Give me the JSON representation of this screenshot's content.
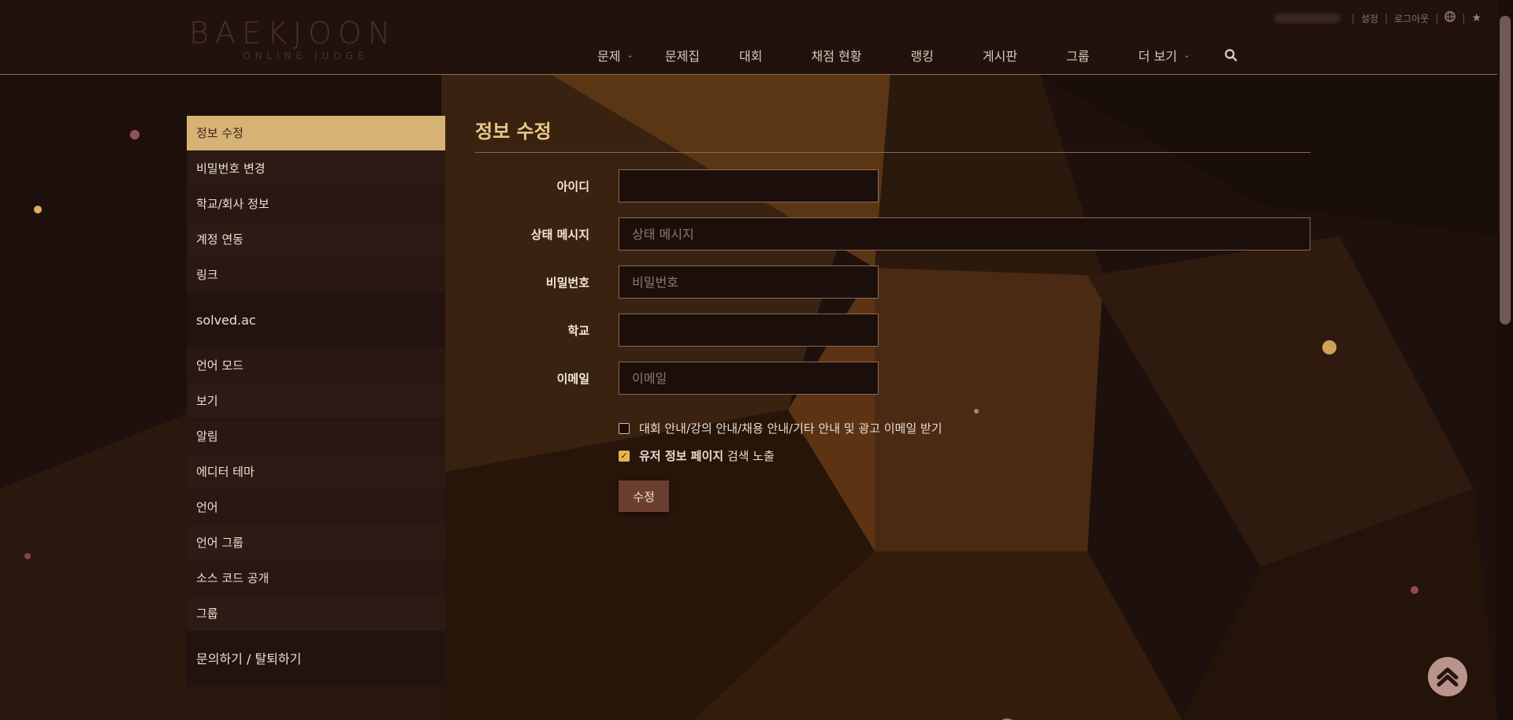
{
  "brand": {
    "name": "BAEKJOON",
    "subtitle": "ONLINE JUDGE"
  },
  "util": {
    "settings": "설정",
    "logout": "로그아웃"
  },
  "nav": [
    {
      "label": "문제",
      "dropdown": true
    },
    {
      "label": "문제집",
      "dropdown": false
    },
    {
      "label": "대회",
      "dropdown": false
    },
    {
      "label": "채점 현황",
      "dropdown": false
    },
    {
      "label": "랭킹",
      "dropdown": false
    },
    {
      "label": "게시판",
      "dropdown": false
    },
    {
      "label": "그룹",
      "dropdown": false
    },
    {
      "label": "더 보기",
      "dropdown": true
    }
  ],
  "sidebar": {
    "items": [
      "정보 수정",
      "비밀번호 변경",
      "학교/회사 정보",
      "계정 연동",
      "링크",
      "solved.ac",
      "언어 모드",
      "보기",
      "알림",
      "에디터 테마",
      "언어",
      "언어 그룹",
      "소스 코드 공개",
      "그룹",
      "문의하기 / 탈퇴하기"
    ]
  },
  "form": {
    "title": "정보 수정",
    "id_label": "아이디",
    "id_value": "",
    "status_label": "상태 메시지",
    "status_placeholder": "상태 메시지",
    "password_label": "비밀번호",
    "password_placeholder": "비밀번호",
    "school_label": "학교",
    "school_value": "",
    "email_label": "이메일",
    "email_placeholder": "이메일",
    "check1": "대회 안내/강의 안내/채용 안내/기타 안내 및 광고 이메일 받기",
    "check1_checked": false,
    "check2_bold": "유저 정보 페이지",
    "check2_rest": " 검색 노출",
    "check2_checked": true,
    "submit": "수정"
  },
  "colors": {
    "accent": "#d6b275",
    "title": "#e8c88c",
    "button": "#6b3f30"
  }
}
